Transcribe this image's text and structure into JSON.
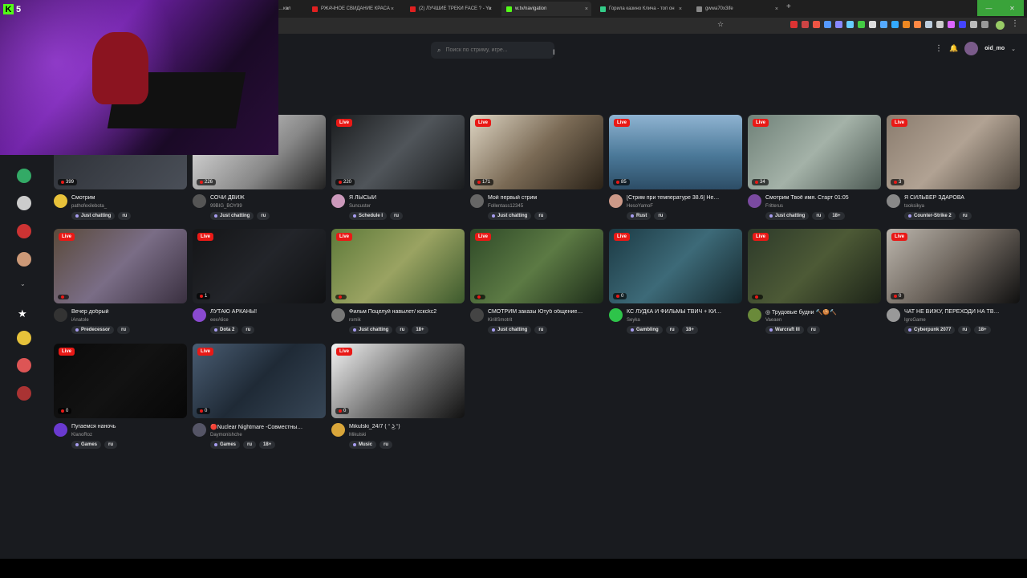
{
  "browser": {
    "tabs": [
      {
        "label": "…кол",
        "fav": "#d32"
      },
      {
        "label": "РЖАЧНОЕ СВИДАНИЕ КРАСА",
        "fav": "#e02020"
      },
      {
        "label": "(2) ЛУЧШИЕ ТРЕКИ FACE ? - Yo",
        "fav": "#e02020"
      },
      {
        "label": "w.tv/navigation",
        "fav": "#53fc18"
      },
      {
        "label": "Горила казино Клича - топ он",
        "fav": "#3c8"
      },
      {
        "label": "gwwa70x3ife",
        "fav": "#888"
      }
    ],
    "new_tab": "+",
    "star": "☆",
    "window_min": "—",
    "window_max": "❐",
    "window_close": "✕",
    "extensions": [
      "#d33",
      "#c44",
      "#e54",
      "#59f",
      "#88f",
      "#6cf",
      "#4c4",
      "#ddd",
      "#5af",
      "#3af",
      "#e82",
      "#f84",
      "#bcd",
      "#ccc",
      "#d6f",
      "#44f",
      "#bbb",
      "#999"
    ]
  },
  "webcam": {
    "logo_letter": "K",
    "logo_num": "5"
  },
  "header": {
    "search_placeholder": "Поиск по стриму, игре...",
    "search_icon": "⌕",
    "cursor": "I",
    "menu_icon": "⋮",
    "bell_icon": "🔔",
    "username": "oid_mo",
    "chevron": "⌄"
  },
  "sidebar": {
    "items": [
      {
        "color": "#3a6"
      },
      {
        "color": "#ccc"
      },
      {
        "color": "#c33"
      },
      {
        "color": "#c97"
      }
    ],
    "expand_icon": "⌄",
    "star_icon": "★",
    "followed": [
      {
        "color": "#e6c23a"
      },
      {
        "color": "#d55"
      },
      {
        "color": "#a33"
      }
    ]
  },
  "cards": [
    {
      "title": "Смотрим",
      "channel": "pathofexilebota_",
      "viewers": "399",
      "tags": [
        "Just chatting",
        "ru"
      ],
      "dot_tag": true,
      "bg": "linear-gradient(135deg,#2a2d33,#4a4f58)",
      "avatar": "#e8c23a",
      "live": false
    },
    {
      "title": "СОЧИ ДВИЖ",
      "channel": "99BIG_BOY99",
      "viewers": "226",
      "tags": [
        "Just chatting",
        "ru"
      ],
      "dot_tag": true,
      "bg": "linear-gradient(135deg,#eaeaea,#888 60%,#222)",
      "avatar": "#555",
      "live": false
    },
    {
      "title": "Я ЛЫСЫЙ",
      "channel": "Suncuster",
      "viewers": "220",
      "tags": [
        "Schedule I",
        "ru"
      ],
      "dot_tag": true,
      "bg": "linear-gradient(135deg,#1b1d1f,#50555a 50%,#1a1c1e)",
      "avatar": "#c9b",
      "live": true
    },
    {
      "title": "Мой первый стрим",
      "channel": "Follentass12345",
      "viewers": "171",
      "tags": [
        "Just chatting",
        "ru"
      ],
      "dot_tag": true,
      "bg": "linear-gradient(135deg,#ddd4c2,#7a6a55 50%,#2a2218)",
      "avatar": "#666",
      "live": true
    },
    {
      "title": "[Стрим при температуре 38.6] Не…",
      "channel": "HesoYamoF",
      "viewers": "85",
      "tags": [
        "Rust",
        "ru"
      ],
      "dot_tag": true,
      "bg": "linear-gradient(180deg,#8fb3d1,#4a7898 55%,#2d4d66)",
      "avatar": "#c98",
      "live": true
    },
    {
      "title": "Смотрим Твоё имя. Старт 01:05",
      "channel": "Fritterus",
      "viewers": "34",
      "tags": [
        "Just chatting",
        "ru",
        "18+"
      ],
      "dot_tag": true,
      "bg": "linear-gradient(135deg,#6f8178,#a4b2a8 50%,#4d5a54)",
      "avatar": "#7a4aa0",
      "live": true
    },
    {
      "title": "Я СИЛЬВЕР ЗДАРОВА",
      "channel": "tooksikya",
      "viewers": "3",
      "tags": [
        "Counter-Strike 2",
        "ru"
      ],
      "dot_tag": true,
      "bg": "linear-gradient(135deg,#8a7c6e,#b1a293 50%,#4d453c)",
      "avatar": "#888",
      "live": true
    },
    {
      "title": "Вечер добрый",
      "channel": "iAnatole",
      "viewers": "",
      "tags": [
        "Predecessor",
        "ru"
      ],
      "dot_tag": true,
      "bg": "linear-gradient(135deg,#5a4a3a,#7a6d86 50%,#3a3040)",
      "avatar": "#333",
      "live": true
    },
    {
      "title": "ЛУТАЮ АРКАНЫ!",
      "channel": "eexAlice",
      "viewers": "1",
      "tags": [
        "Dota 2",
        "ru"
      ],
      "dot_tag": true,
      "bg": "linear-gradient(135deg,#141517,#23252a 50%,#101113)",
      "avatar": "#8a4ad0",
      "live": true
    },
    {
      "title": "Фильм Поцелуй навылет/ ксксkc2",
      "channel": "romik",
      "viewers": "",
      "tags": [
        "Just chatting",
        "ru",
        "18+"
      ],
      "dot_tag": true,
      "bg": "linear-gradient(135deg,#5e7a3a,#9aa362 50%,#3d5a2d)",
      "avatar": "#777",
      "live": true
    },
    {
      "title": "СМОТРИМ заказы Ютуб общение…",
      "channel": "KirillSmotrit",
      "viewers": "",
      "tags": [
        "Just chatting",
        "ru"
      ],
      "dot_tag": true,
      "bg": "linear-gradient(135deg,#2f4a28,#5c7a44 50%,#1e2e1a)",
      "avatar": "#444",
      "live": true
    },
    {
      "title": "КС ЛУДКА И ФИЛЬМЫ ТВИЧ + КИ…",
      "channel": "Seyka",
      "viewers": "0",
      "tags": [
        "Gambling",
        "ru",
        "18+"
      ],
      "dot_tag": true,
      "bg": "linear-gradient(135deg,#1c3a44,#3d6a78 50%,#15282e)",
      "avatar": "#2ec44a",
      "live": true
    },
    {
      "title": "◎ Трудовые будни 🔨🍪🔨",
      "channel": "Vaeaen",
      "viewers": "",
      "tags": [
        "Warcraft III",
        "ru"
      ],
      "dot_tag": true,
      "bg": "linear-gradient(135deg,#2d3a2a,#4d5a36 50%,#1d2418)",
      "avatar": "#6a8a3a",
      "live": true
    },
    {
      "title": "ЧАТ НЕ ВИЖУ, ПЕРЕХОДИ НА ТВ…",
      "channel": "IgroGame",
      "viewers": "0",
      "tags": [
        "Cyberpunk 2077",
        "ru",
        "18+"
      ],
      "dot_tag": true,
      "bg": "linear-gradient(135deg,#bcb6ad,#6e665e 50%,#101010)",
      "avatar": "#999",
      "live": true
    },
    {
      "title": "Пугаемся наночь",
      "channel": "KlanoRoz",
      "viewers": "0",
      "tags": [
        "Games",
        "ru"
      ],
      "dot_tag": true,
      "bg": "linear-gradient(135deg,#0a0a0a,#121212 50%,#070707)",
      "avatar": "#6a3ad0",
      "live": true
    },
    {
      "title": "🔴Nuclear Nightmare -Совместны…",
      "channel": "Daymonishche",
      "viewers": "0",
      "tags": [
        "Games",
        "ru",
        "18+"
      ],
      "dot_tag": true,
      "bg": "linear-gradient(135deg,#4a5d73,#1f2a36 50%,#374656)",
      "avatar": "#556",
      "live": true
    },
    {
      "title": "Mikulski_24/7 ( ᵔ ͜ʖ ᵔ)",
      "channel": "Mikulski",
      "viewers": "0",
      "tags": [
        "Music",
        "ru"
      ],
      "dot_tag": true,
      "bg": "linear-gradient(135deg,#f3f3f3,#777 50%,#111)",
      "avatar": "#d9a63a",
      "live": true
    }
  ],
  "labels": {
    "live": "Live"
  }
}
